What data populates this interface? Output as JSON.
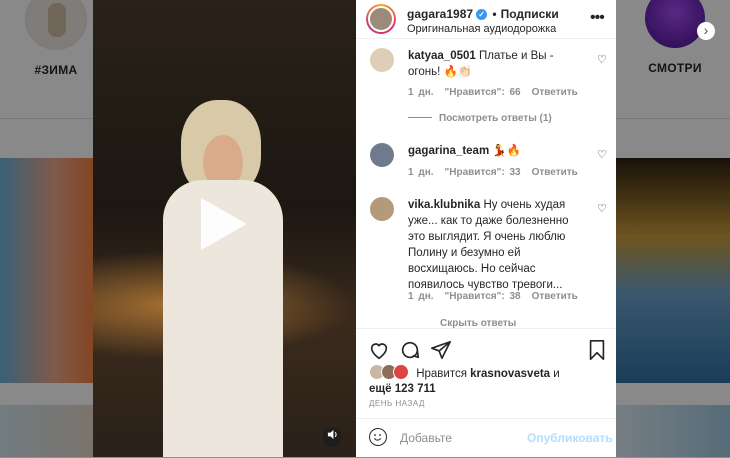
{
  "background": {
    "highlights": [
      {
        "label": "#ЗИМА"
      },
      {
        "label": "СМОТРИ"
      }
    ],
    "next_icon": "chevron-right-icon"
  },
  "post": {
    "username": "gagara1987",
    "verified_icon": "verified-badge-icon",
    "follow_separator": "•",
    "follow_label": "Подписки",
    "audio_label": "Оригинальная аудиодорожка",
    "more_icon": "more-horizontal-icon",
    "video": {
      "play_icon": "play-icon",
      "mute_icon": "speaker-icon"
    }
  },
  "comments": [
    {
      "user": "katyaa_0501",
      "text": "Платье и Вы - огонь! 🔥👏🏻",
      "age": "1 дн.",
      "likes": "\"Нравится\": 66",
      "reply": "Ответить",
      "view_replies": "Посмотреть ответы (1)"
    },
    {
      "user": "gagarina_team",
      "text": "💃🔥",
      "age": "1 дн.",
      "likes": "\"Нравится\": 33",
      "reply": "Ответить"
    },
    {
      "user": "vika.klubnika",
      "text": "Ну очень худая уже... как то даже болезненно это выглядит. Я очень люблю Полину и безумно ей восхищаюсь. Но сейчас появилось чувство тревоги...",
      "age": "1 дн.",
      "likes": "\"Нравится\": 38",
      "reply": "Ответить",
      "hide_replies": "Скрыть ответы"
    }
  ],
  "actions": {
    "liked_by_prefix": "Нравится",
    "liked_by_user": "krasnovasveta",
    "liked_by_and": "и",
    "liked_by_more": "ещё 123 711",
    "time": "ДЕНЬ НАЗАД"
  },
  "add_comment": {
    "placeholder": "Добавьте",
    "publish": "Опубликовать",
    "emoji_icon": "smiley-icon"
  },
  "colors": {
    "link_blue": "#3897f0",
    "publish_disabled": "#b2dffc",
    "secondary_text": "#8e8e8e"
  }
}
